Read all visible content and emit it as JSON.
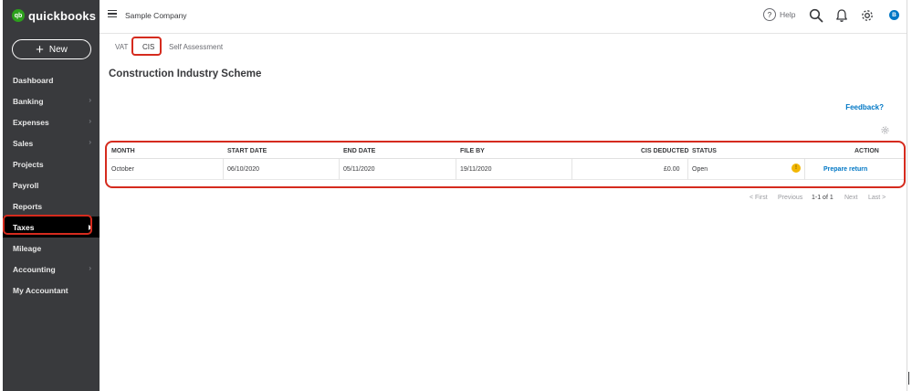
{
  "app": {
    "brand_mark": "qb",
    "brand_name": "quickbooks"
  },
  "sidebar": {
    "new_label": "New",
    "items": [
      {
        "label": "Dashboard",
        "chevron": false
      },
      {
        "label": "Banking",
        "chevron": true
      },
      {
        "label": "Expenses",
        "chevron": true
      },
      {
        "label": "Sales",
        "chevron": true
      },
      {
        "label": "Projects",
        "chevron": false
      },
      {
        "label": "Payroll",
        "chevron": false
      },
      {
        "label": "Reports",
        "chevron": false
      },
      {
        "label": "Taxes",
        "chevron": false,
        "active": true
      },
      {
        "label": "Mileage",
        "chevron": false
      },
      {
        "label": "Accounting",
        "chevron": true
      },
      {
        "label": "My Accountant",
        "chevron": false
      }
    ]
  },
  "header": {
    "company": "Sample Company",
    "help": "Help",
    "avatar_initial": "B"
  },
  "tabs": [
    {
      "label": "VAT"
    },
    {
      "label": "CIS",
      "active": true
    },
    {
      "label": "Self Assessment"
    }
  ],
  "main": {
    "title": "Construction Industry Scheme",
    "feedback": "Feedback?"
  },
  "table": {
    "columns": [
      "MONTH",
      "START DATE",
      "END DATE",
      "FILE BY",
      "CIS DEDUCTED",
      "STATUS",
      "ACTION"
    ],
    "rows": [
      {
        "month": "October",
        "start_date": "06/10/2020",
        "end_date": "05/11/2020",
        "file_by": "19/11/2020",
        "cis_deducted": "£0.00",
        "status": "Open",
        "status_icon": "!",
        "action": "Prepare return"
      }
    ]
  },
  "pagination": {
    "first": "< First",
    "previous": "Previous",
    "range": "1-1 of 1",
    "next": "Next",
    "last": "Last >"
  },
  "colors": {
    "sidebar_bg": "#393a3d",
    "active_nav": "#000000",
    "brand_green": "#2ca01c",
    "link_blue": "#0077c5",
    "annotation_red": "#d52b1e",
    "warning_yellow": "#f2b705"
  },
  "icons": {
    "search": "search-icon",
    "notifications": "bell-icon",
    "settings": "gear-icon",
    "menu": "hamburger-icon"
  }
}
